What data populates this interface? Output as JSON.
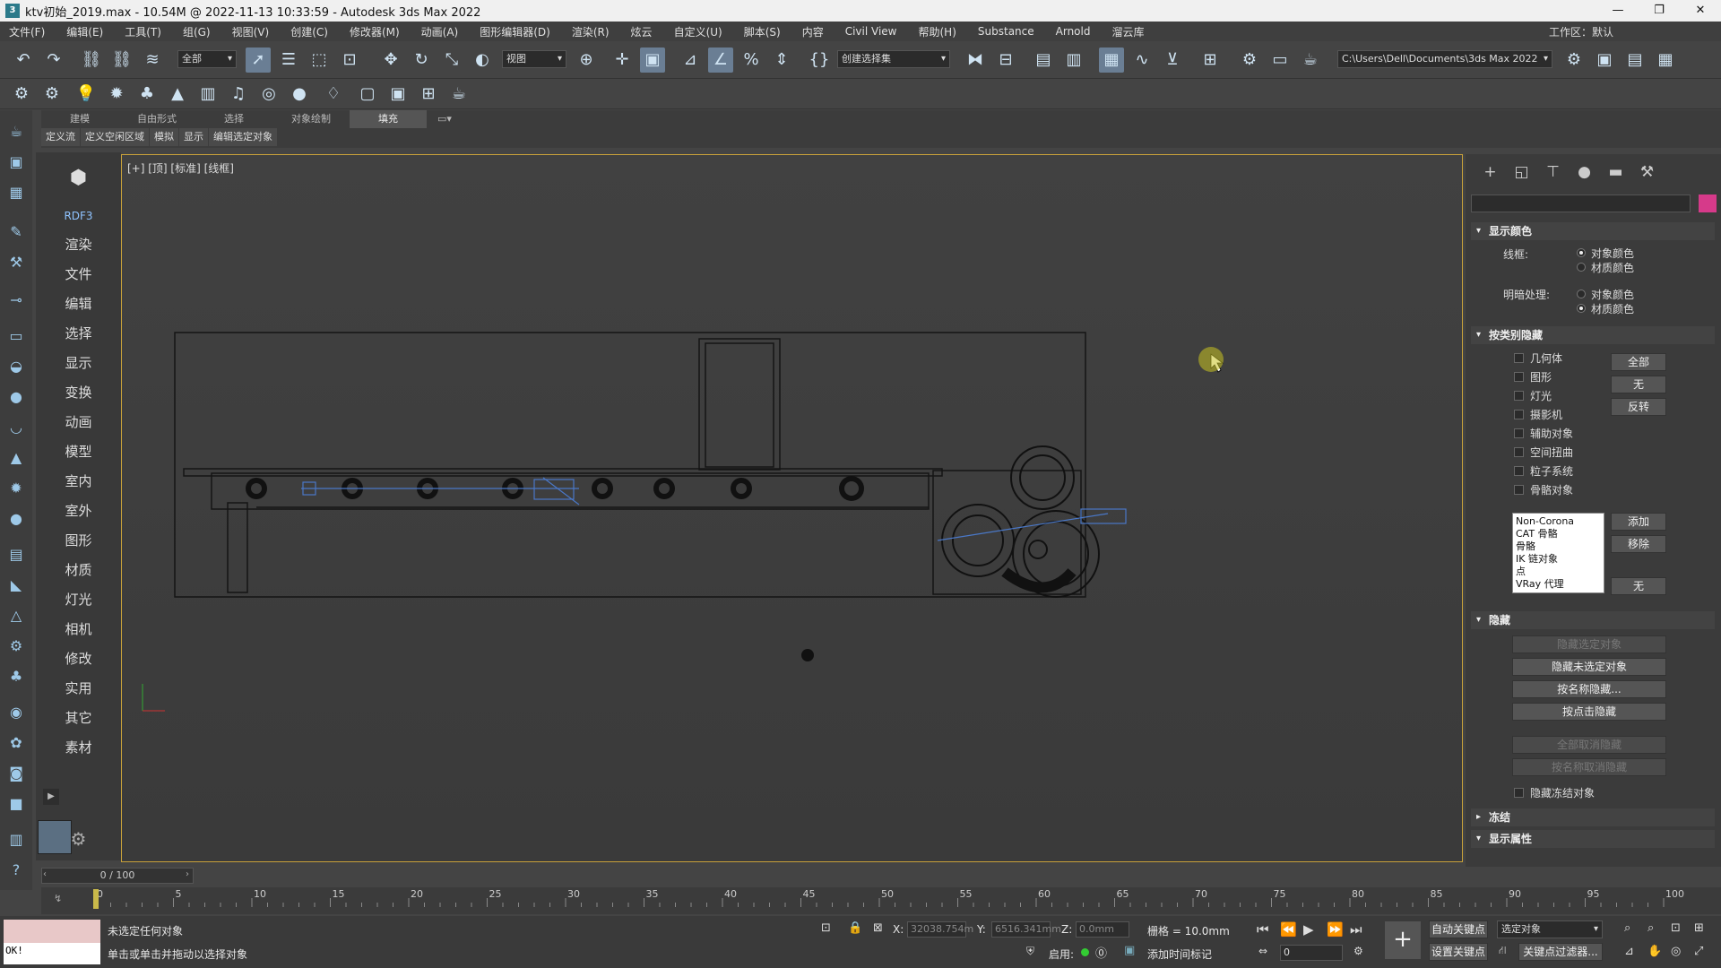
{
  "title_bar": {
    "title": "ktv初始_2019.max - 10.54M @ 2022-11-13 10:33:59 - Autodesk 3ds Max 2022",
    "min": "—",
    "max": "❐",
    "close": "✕"
  },
  "menu": {
    "items": [
      "文件(F)",
      "编辑(E)",
      "工具(T)",
      "组(G)",
      "视图(V)",
      "创建(C)",
      "修改器(M)",
      "动画(A)",
      "图形编辑器(D)",
      "渲染(R)",
      "炫云",
      "自定义(U)",
      "脚本(S)",
      "内容",
      "Civil View",
      "帮助(H)",
      "Substance",
      "Arnold",
      "溜云库"
    ],
    "workspace": "工作区：默认"
  },
  "toolbar": {
    "selection_filter": "全部",
    "reference_coord": "视图",
    "named_selection": "创建选择集",
    "project_path": "C:\\Users\\Dell\\Documents\\3ds Max 2022"
  },
  "ribbon": {
    "tabs": [
      "建模",
      "自由形式",
      "选择",
      "对象绘制",
      "填充"
    ],
    "active_tab": 4,
    "subtabs": [
      "定义流",
      "定义空闲区域",
      "模拟",
      "显示",
      "编辑选定对象"
    ]
  },
  "categories": [
    "RDF3",
    "渲染",
    "文件",
    "编辑",
    "选择",
    "显示",
    "变换",
    "动画",
    "模型",
    "室内",
    "室外",
    "图形",
    "材质",
    "灯光",
    "相机",
    "修改",
    "实用",
    "其它",
    "素材"
  ],
  "viewport": {
    "label": "[+] [顶] [标准] [线框]"
  },
  "command_panel": {
    "display_color": {
      "title": "显示颜色",
      "wireframe_label": "线框:",
      "shaded_label": "明暗处理:",
      "opt_object_color": "对象颜色",
      "opt_material_color": "材质颜色"
    },
    "hide_by_category": {
      "title": "按类别隐藏",
      "items": [
        "几何体",
        "图形",
        "灯光",
        "摄影机",
        "辅助对象",
        "空间扭曲",
        "粒子系统",
        "骨骼对象"
      ],
      "btn_all": "全部",
      "btn_none": "无",
      "btn_invert": "反转",
      "list_items": [
        "Non-Corona",
        "CAT 骨骼",
        "骨骼",
        "IK 链对象",
        "点",
        "VRay 代理"
      ],
      "btn_add": "添加",
      "btn_remove": "移除",
      "btn_none2": "无"
    },
    "hide": {
      "title": "隐藏",
      "buttons": [
        "隐藏选定对象",
        "隐藏未选定对象",
        "按名称隐藏...",
        "按点击隐藏",
        "全部取消隐藏",
        "按名称取消隐藏"
      ],
      "freeze_check": "隐藏冻结对象"
    },
    "freeze": {
      "title": "冻结"
    },
    "display_props": {
      "title": "显示属性"
    }
  },
  "timeline": {
    "slider_text": "0 / 100",
    "ticks": [
      "0",
      "5",
      "10",
      "15",
      "20",
      "25",
      "30",
      "35",
      "40",
      "45",
      "50",
      "55",
      "60",
      "65",
      "70",
      "75",
      "80",
      "85",
      "90",
      "95",
      "100"
    ]
  },
  "status": {
    "line1": "未选定任何对象",
    "line2": "单击或单击并拖动以选择对象",
    "script_output": "OK!",
    "x_label": "X:",
    "x_value": "32038.754m",
    "y_label": "Y:",
    "y_value": "6516.341mm",
    "z_label": "Z:",
    "z_value": "0.0mm",
    "grid": "栅格 = 10.0mm",
    "enable": "启用:",
    "add_time_tag": "添加时间标记",
    "auto_key": "自动关键点",
    "set_key": "设置关键点",
    "selected_object": "选定对象",
    "key_filters": "关键点过滤器...",
    "frame": "0"
  }
}
